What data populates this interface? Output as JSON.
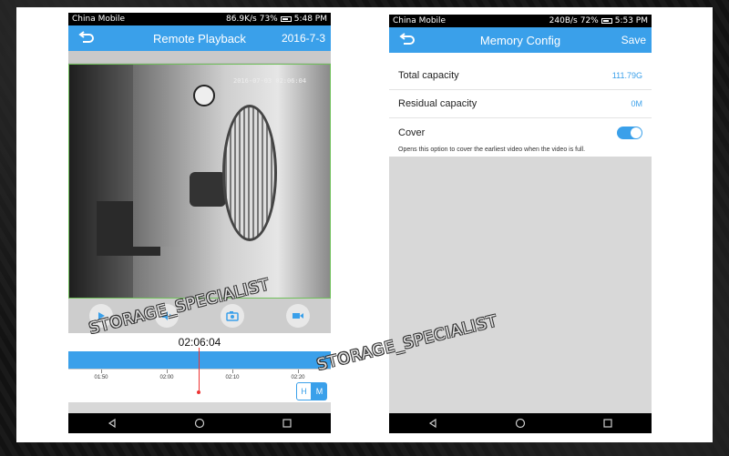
{
  "left_screen": {
    "status": {
      "carrier": "China Mobile",
      "speed": "86.9K/s",
      "battery": "73%",
      "time": "5:48 PM"
    },
    "header": {
      "title": "Remote Playback",
      "date": "2016-7-3"
    },
    "video": {
      "osd_text": "2016-07-03 02:06:04"
    },
    "controls": [
      {
        "name": "playback-control",
        "icon": "play-icon"
      },
      {
        "name": "audio-control",
        "icon": "speaker-icon"
      },
      {
        "name": "snapshot-control",
        "icon": "camera-icon"
      },
      {
        "name": "record-control",
        "icon": "video-record-icon"
      }
    ],
    "playback_time": "02:06:04",
    "timeline_ticks": [
      "01:50",
      "02:00",
      "02:10",
      "02:20"
    ],
    "hm": {
      "h": "H",
      "m": "M"
    }
  },
  "right_screen": {
    "status": {
      "carrier": "China Mobile",
      "speed": "240B/s",
      "battery": "72%",
      "time": "5:53 PM"
    },
    "header": {
      "title": "Memory Config",
      "save_label": "Save"
    },
    "total_capacity": {
      "label": "Total capacity",
      "value": "111.79G"
    },
    "residual_capacity": {
      "label": "Residual capacity",
      "value": "0M"
    },
    "cover": {
      "label": "Cover",
      "enabled": true,
      "hint": "Opens this option to cover the earliest video when the video is full."
    }
  },
  "watermark": "STORAGE_SPECIALIST",
  "colors": {
    "accent": "#3aa0ea",
    "cursor": "#ee3333"
  }
}
